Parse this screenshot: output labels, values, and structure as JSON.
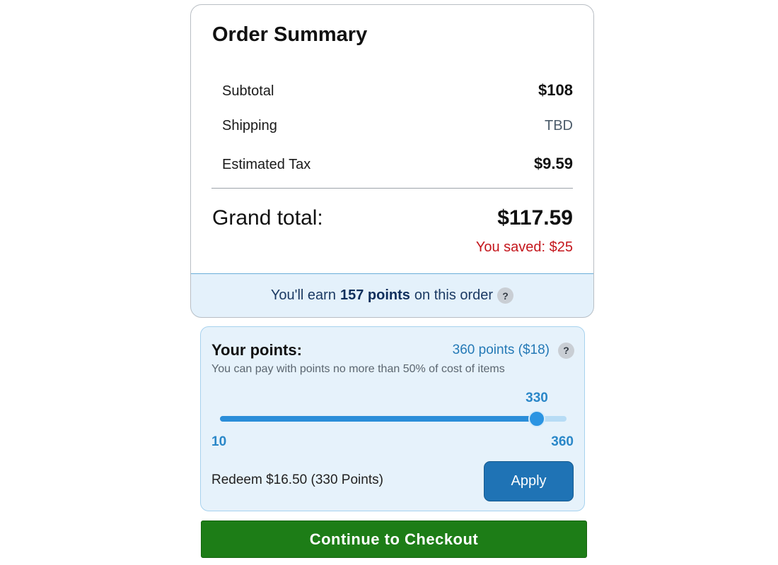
{
  "summary": {
    "title": "Order Summary",
    "rows": [
      {
        "label": "Subtotal",
        "value": "$108"
      },
      {
        "label": "Shipping",
        "value": "TBD"
      },
      {
        "label": "Estimated Tax",
        "value": "$9.59"
      }
    ],
    "grand_total_label": "Grand total:",
    "grand_total_value": "$117.59",
    "saved_text": "You saved: $25"
  },
  "earn_banner": {
    "prefix": "You'll earn",
    "points": "157 points",
    "suffix": "on this order",
    "help_icon": "?"
  },
  "points": {
    "title": "Your points:",
    "balance": "360 points ($18)",
    "help_icon": "?",
    "note": "You can pay with points no more than 50% of cost of items",
    "slider": {
      "min": 10,
      "max": 360,
      "value": 330,
      "min_label": "10",
      "max_label": "360",
      "value_label": "330"
    },
    "redeem_text": "Redeem $16.50 (330 Points)",
    "apply_label": "Apply"
  },
  "checkout_label": "Continue to Checkout",
  "colors": {
    "accent_blue": "#2b8ed9",
    "checkout_green": "#1d7d17",
    "savings_red": "#c4161c",
    "apply_blue": "#1f73b5"
  },
  "icons": {
    "help": "question-circle-icon"
  }
}
